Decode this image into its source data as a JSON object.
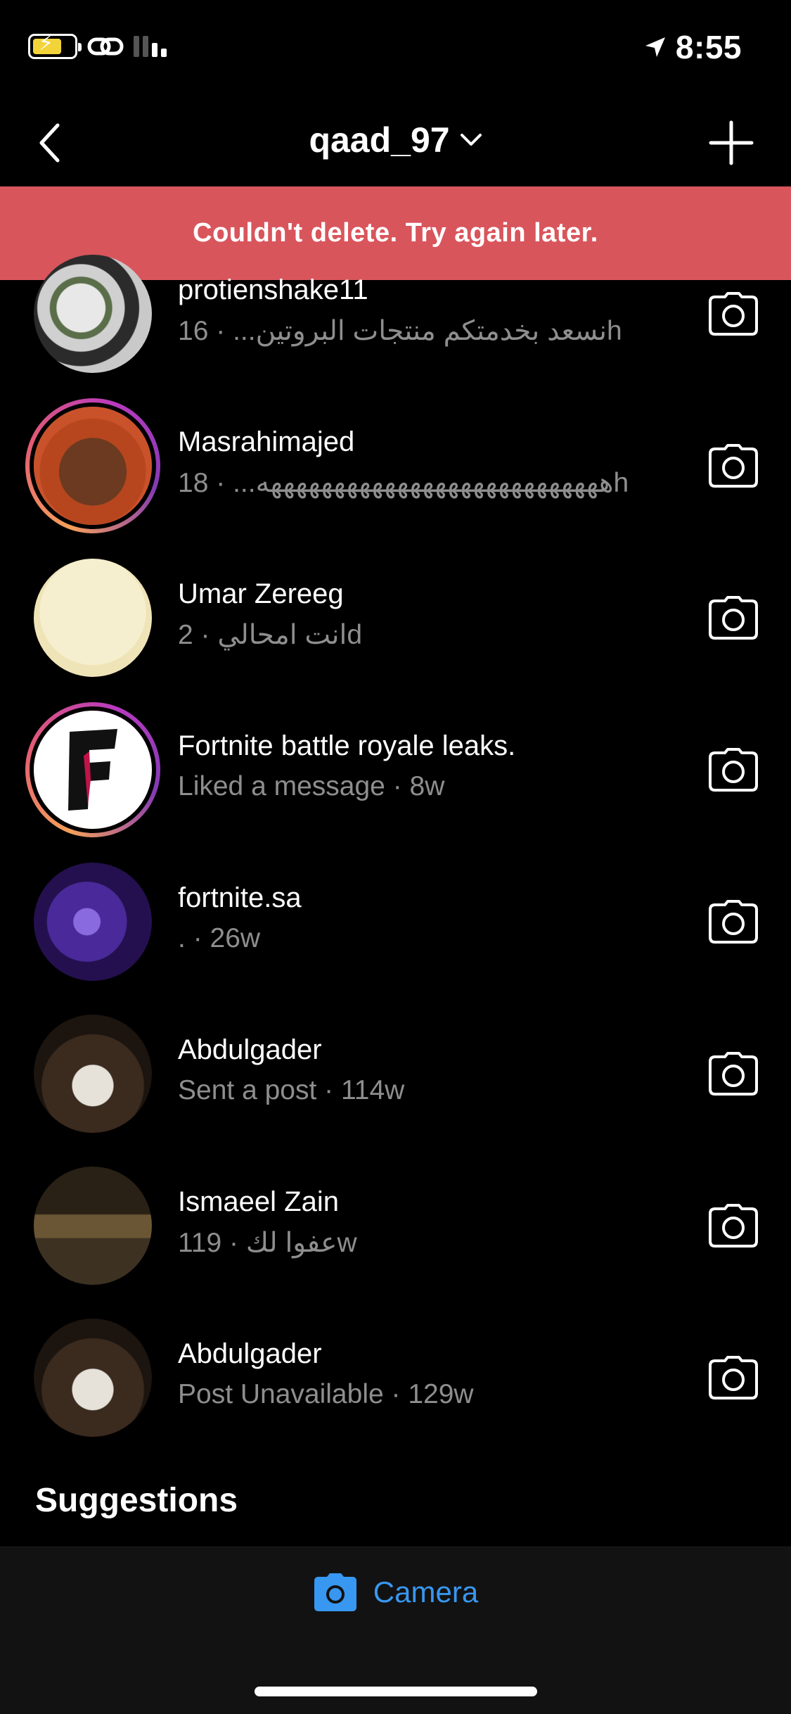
{
  "status_bar": {
    "time": "8:55",
    "icons": [
      "battery-charging-icon",
      "link-icon",
      "signal-icon",
      "location-arrow-icon"
    ]
  },
  "header": {
    "title": "qaad_97",
    "icons": [
      "back-chevron-icon",
      "chevron-down-icon",
      "plus-icon"
    ]
  },
  "banner": {
    "text": "Couldn't delete. Try again later."
  },
  "threads": [
    {
      "name": "protienshake11",
      "preview": "نسعد بخدمتكم منتجات البروتين...",
      "time": "16h"
    },
    {
      "name": "Masrahimajed",
      "preview": "هههههههههههههههههههههههههههه...",
      "time": "18h"
    },
    {
      "name": "Umar Zereeg",
      "preview": "انت امحالي",
      "time": "2d"
    },
    {
      "name": "Fortnite battle royale leaks.",
      "preview": "Liked a message",
      "time": "8w"
    },
    {
      "name": "fortnite.sa",
      "preview": ".",
      "time": "26w"
    },
    {
      "name": "Abdulgader",
      "preview": "Sent a post",
      "time": "114w"
    },
    {
      "name": "Ismaeel Zain",
      "preview": "عفوا لك",
      "time": "119w"
    },
    {
      "name": "Abdulgader",
      "preview": "Post Unavailable",
      "time": "129w"
    }
  ],
  "suggestions_label": "Suggestions",
  "bottom_bar": {
    "camera_label": "Camera"
  },
  "colors": {
    "background": "#000000",
    "banner": "#d9555c",
    "secondary_text": "#8e8e8e",
    "accent": "#3897f0"
  }
}
